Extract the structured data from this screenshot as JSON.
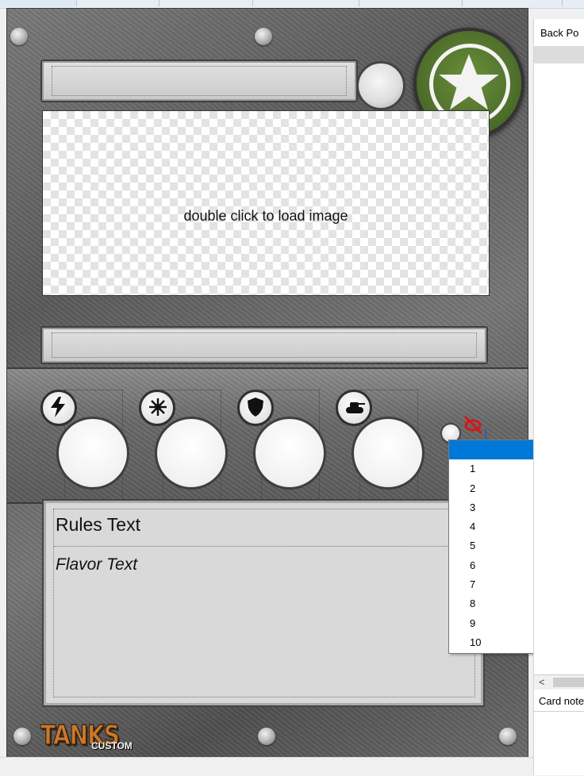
{
  "card_editor": {
    "image_placeholder": "double click to load image",
    "rules_text": "Rules Text",
    "flavor_text": "Flavor Text",
    "logo": {
      "word": "TANKS",
      "sub": "CUSTOM"
    },
    "badge_icon": "star-icon",
    "stats": [
      {
        "icon": "lightning-icon"
      },
      {
        "icon": "burst-icon"
      },
      {
        "icon": "shield-icon"
      },
      {
        "icon": "tank-icon"
      }
    ]
  },
  "dropdown": {
    "selected_index": 0,
    "options": [
      "",
      "1",
      "2",
      "3",
      "4",
      "5",
      "6",
      "7",
      "8",
      "9",
      "10"
    ]
  },
  "right_panel": {
    "header": "Back Po",
    "notes_label": "Card note",
    "scroll_left_glyph": "<"
  },
  "colors": {
    "selection": "#0078d7",
    "badge_green": "#4b6a2a",
    "metal": "#6a6a6a"
  }
}
